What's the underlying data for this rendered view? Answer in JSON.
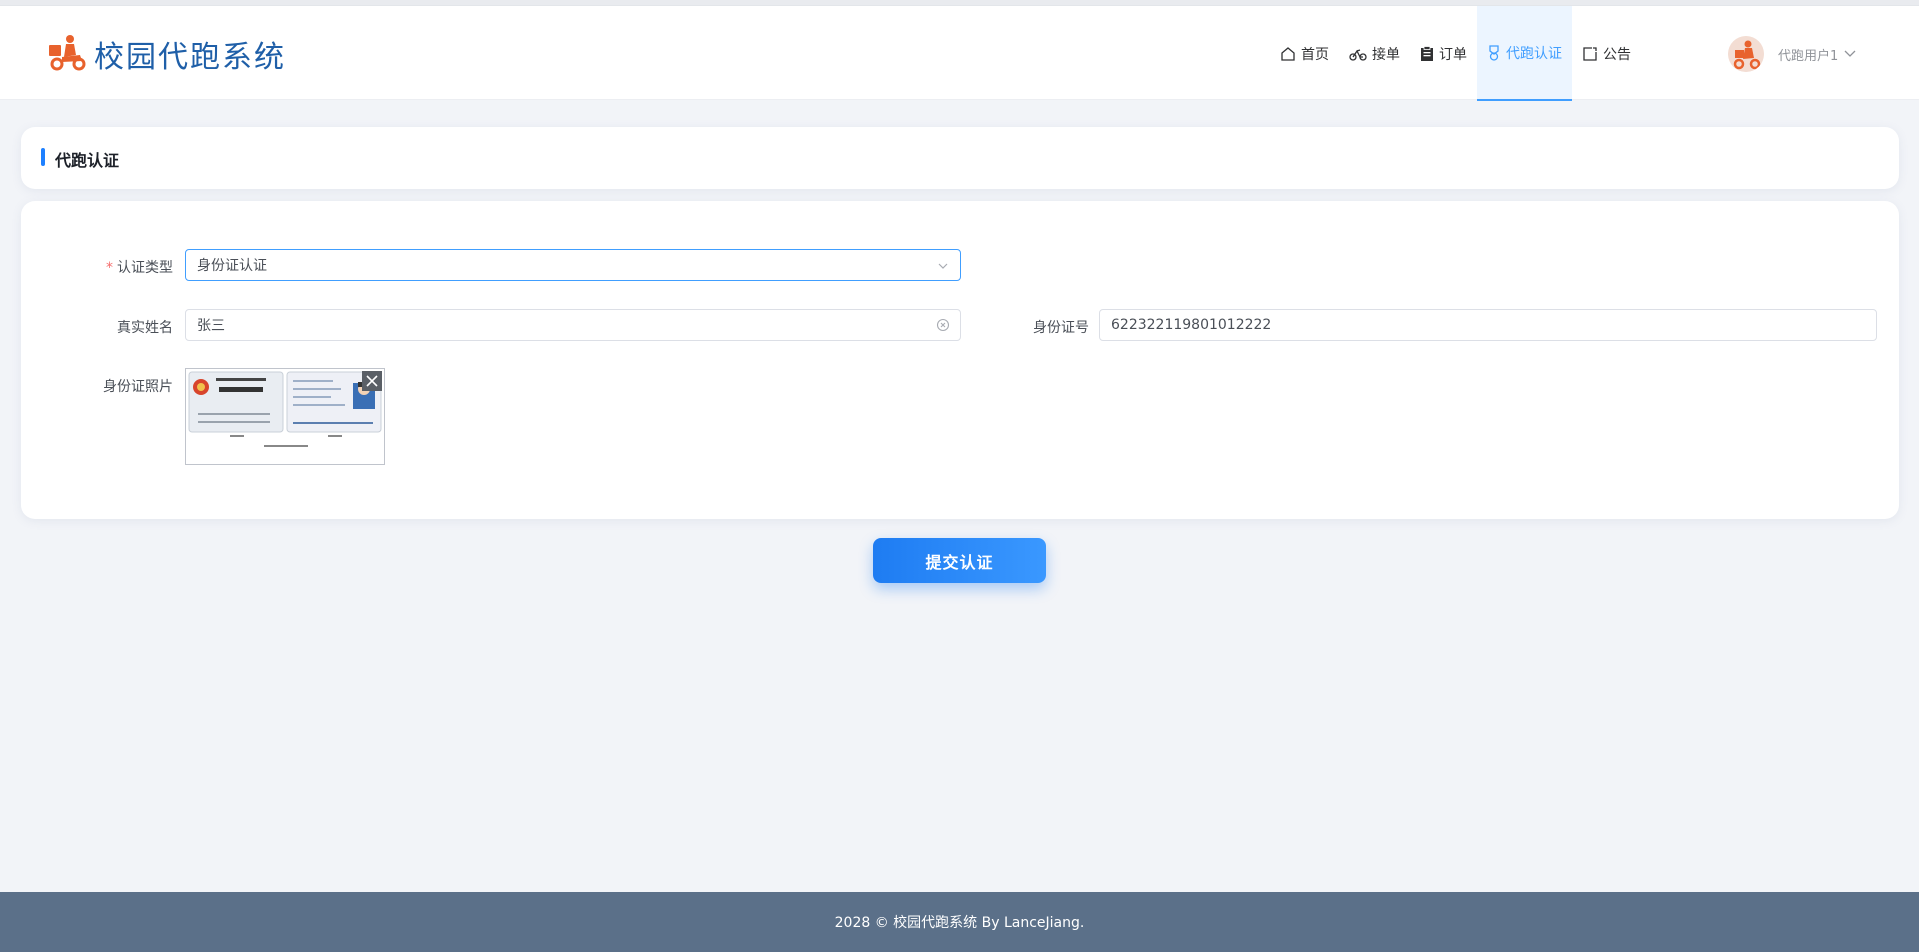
{
  "app": {
    "title": "校园代跑系统",
    "accent": "#409eff",
    "brand": "#1f5fa8"
  },
  "nav": {
    "items": [
      {
        "label": "首页",
        "icon": "home-icon"
      },
      {
        "label": "接单",
        "icon": "bicycle-icon"
      },
      {
        "label": "订单",
        "icon": "clipboard-icon"
      },
      {
        "label": "代跑认证",
        "icon": "medal-icon",
        "active": true
      },
      {
        "label": "公告",
        "icon": "notice-icon"
      }
    ]
  },
  "user": {
    "name": "代跑用户1"
  },
  "page": {
    "title": "代跑认证"
  },
  "form": {
    "auth_type_label": "认证类型",
    "auth_type_value": "身份证认证",
    "real_name_label": "真实姓名",
    "real_name_value": "张三",
    "id_number_label": "身份证号",
    "id_number_value": "622322119801012222",
    "id_photo_label": "身份证照片"
  },
  "actions": {
    "submit_label": "提交认证"
  },
  "footer": {
    "text": "2028 © 校园代跑系统 By LanceJiang."
  }
}
